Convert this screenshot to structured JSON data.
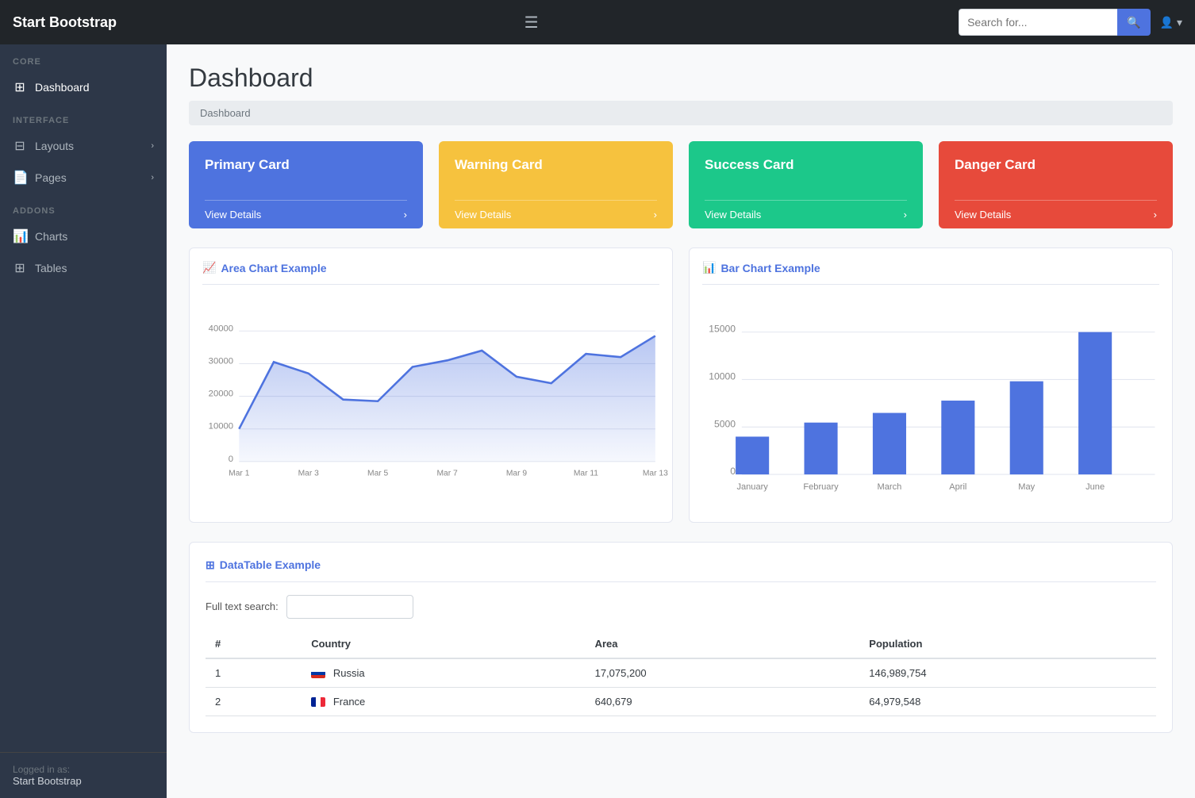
{
  "app": {
    "brand": "Start Bootstrap",
    "search_placeholder": "Search for...",
    "user_label": "User"
  },
  "sidebar": {
    "sections": [
      {
        "label": "CORE",
        "items": [
          {
            "id": "dashboard",
            "label": "Dashboard",
            "icon": "⊞",
            "active": true
          }
        ]
      },
      {
        "label": "INTERFACE",
        "items": [
          {
            "id": "layouts",
            "label": "Layouts",
            "icon": "⊟",
            "arrow": "›"
          },
          {
            "id": "pages",
            "label": "Pages",
            "icon": "📄",
            "arrow": "›"
          }
        ]
      },
      {
        "label": "ADDONS",
        "items": [
          {
            "id": "charts",
            "label": "Charts",
            "icon": "📊"
          },
          {
            "id": "tables",
            "label": "Tables",
            "icon": "⊞"
          }
        ]
      }
    ],
    "footer": {
      "logged_in_label": "Logged in as:",
      "user_name": "Start Bootstrap"
    }
  },
  "main": {
    "title": "Dashboard",
    "breadcrumb": "Dashboard",
    "cards": [
      {
        "id": "primary",
        "type": "primary",
        "title": "Primary Card",
        "link": "View Details"
      },
      {
        "id": "warning",
        "type": "warning",
        "title": "Warning Card",
        "link": "View Details"
      },
      {
        "id": "success",
        "type": "success",
        "title": "Success Card",
        "link": "View Details"
      },
      {
        "id": "danger",
        "type": "danger",
        "title": "Danger Card",
        "link": "View Details"
      }
    ],
    "area_chart": {
      "title": "Area Chart Example",
      "x_labels": [
        "Mar 1",
        "Mar 3",
        "Mar 5",
        "Mar 7",
        "Mar 9",
        "Mar 11",
        "Mar 13"
      ],
      "y_labels": [
        "0",
        "10000",
        "20000",
        "30000",
        "40000"
      ],
      "data": [
        10000,
        30500,
        27000,
        19000,
        18500,
        29000,
        31000,
        34000,
        26000,
        24000,
        33000,
        32000,
        38500
      ]
    },
    "bar_chart": {
      "title": "Bar Chart Example",
      "x_labels": [
        "January",
        "February",
        "March",
        "April",
        "May",
        "June"
      ],
      "y_labels": [
        "0",
        "5000",
        "10000",
        "15000"
      ],
      "data": [
        4000,
        5500,
        6500,
        7800,
        9800,
        15000
      ]
    },
    "datatable": {
      "title": "DataTable Example",
      "search_label": "Full text search:",
      "search_value": "",
      "columns": [
        "#",
        "Country",
        "Area",
        "Population"
      ],
      "rows": [
        {
          "num": "1",
          "country": "Russia",
          "flag": "russia",
          "area": "17,075,200",
          "population": "146,989,754"
        },
        {
          "num": "2",
          "country": "France",
          "flag": "france",
          "area": "640,679",
          "population": "64,979,548"
        }
      ]
    }
  }
}
